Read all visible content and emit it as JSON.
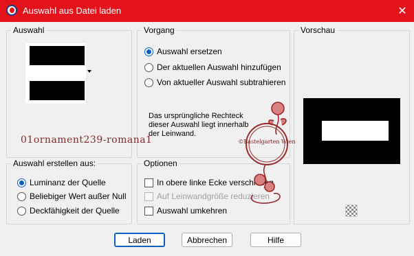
{
  "window": {
    "title": "Auswahl aus Datei laden"
  },
  "groups": {
    "auswahl": {
      "label": "Auswahl"
    },
    "vorgang": {
      "label": "Vorgang",
      "options": [
        {
          "label": "Auswahl ersetzen",
          "selected": true
        },
        {
          "label": "Der aktuellen Auswahl hinzufügen",
          "selected": false
        },
        {
          "label": "Von aktueller Auswahl subtrahieren",
          "selected": false
        }
      ],
      "info": "Das ursprüngliche Rechteck dieser Auswahl liegt innerhalb der Leinwand."
    },
    "vorschau": {
      "label": "Vorschau",
      "icon": "transparency-checker-icon"
    },
    "erstellen": {
      "label": "Auswahl erstellen aus:",
      "options": [
        {
          "label": "Luminanz der Quelle",
          "selected": true
        },
        {
          "label": "Beliebiger Wert außer Null",
          "selected": false
        },
        {
          "label": "Deckfähigkeit der Quelle",
          "selected": false
        }
      ]
    },
    "optionen": {
      "label": "Optionen",
      "checks": [
        {
          "label": "In obere linke Ecke verschieben",
          "checked": false,
          "enabled": true
        },
        {
          "label": "Auf Leinwandgröße reduzieren",
          "checked": false,
          "enabled": false
        },
        {
          "label": "Auswahl umkehren",
          "checked": false,
          "enabled": true
        }
      ]
    }
  },
  "watermark": {
    "text": "01ornament239-romana1",
    "stamp_text": "©Bastelgarten Wien"
  },
  "buttons": {
    "load": "Laden",
    "cancel": "Abbrechen",
    "help": "Hilfe"
  },
  "colors": {
    "titlebar": "#e3121b",
    "accent": "#0a5fc4",
    "watermark": "#7a1e1e"
  }
}
